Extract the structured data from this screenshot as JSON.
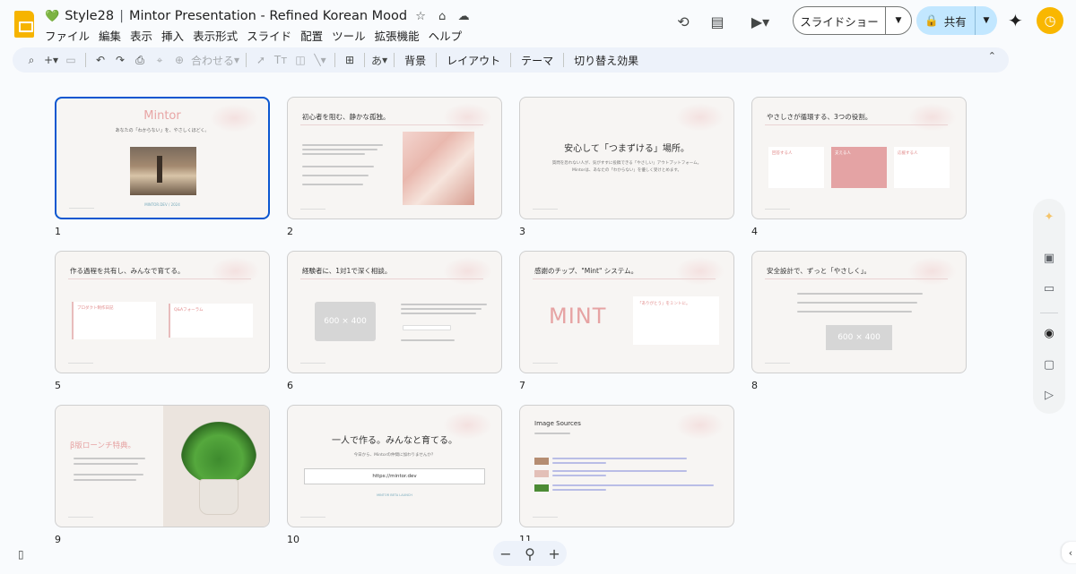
{
  "header": {
    "heart": "💚",
    "doc_title_prefix": "Style28",
    "doc_title_sep": "|",
    "doc_title": "Mintor Presentation - Refined Korean Mood",
    "star_icon": "star-icon",
    "menus": [
      "ファイル",
      "編集",
      "表示",
      "挿入",
      "表示形式",
      "スライド",
      "配置",
      "ツール",
      "拡張機能",
      "ヘルプ"
    ],
    "slideshow_label": "スライドショー",
    "share_label": "共有"
  },
  "toolbar": {
    "zoom_fit": "合わせる",
    "text_tool": "Tт",
    "input_tool": "あ",
    "background": "背景",
    "layout": "レイアウト",
    "theme": "テーマ",
    "transition": "切り替え効果"
  },
  "slides": [
    {
      "number": "1",
      "title": "Mintor",
      "subtitle": "あなたの「わからない」を、やさしくほどく。",
      "caption": "MINTOR.DEV / 2024"
    },
    {
      "number": "2",
      "title": "初心者を阻む、静かな孤独。"
    },
    {
      "number": "3",
      "title": "安心して「つまずける」場所。",
      "subtitle": "質問を恐れない人が、気がすすに投稿できる「やさしい」アウトプットフォーム。",
      "subtitle2": "Mintorは、あなたの「わからない」を優しく受けとめます。"
    },
    {
      "number": "4",
      "title": "やさしさが循環する、3つの役割。",
      "card1": "回答する人",
      "card2": "支える人",
      "card3": "応援する人"
    },
    {
      "number": "5",
      "title": "作る過程を共有し、みんなで育てる。",
      "card1": "プロダクト制作日記",
      "card2": "Q&Aフォーラム"
    },
    {
      "number": "6",
      "title": "経験者に、1対1で深く相談。",
      "placeholder": "600 × 400"
    },
    {
      "number": "7",
      "title": "感謝のチップ、\"Mint\" システム。",
      "mint": "MINT",
      "card_title": "「ありがとう」をミントに。"
    },
    {
      "number": "8",
      "title": "安全設計で、ずっと「やさしく」。",
      "placeholder": "600 × 400"
    },
    {
      "number": "9",
      "title": "β版ローンチ特典。"
    },
    {
      "number": "10",
      "title": "一人で作る。みんなと育てる。",
      "subtitle": "今日から、Mintorの仲間に加わりませんか？",
      "url": "https://mintor.dev",
      "foot": "MINTOR BETA LAUNCH"
    },
    {
      "number": "11",
      "title": "Image Sources"
    }
  ],
  "zoom": {
    "minus": "−",
    "plus": "+"
  }
}
